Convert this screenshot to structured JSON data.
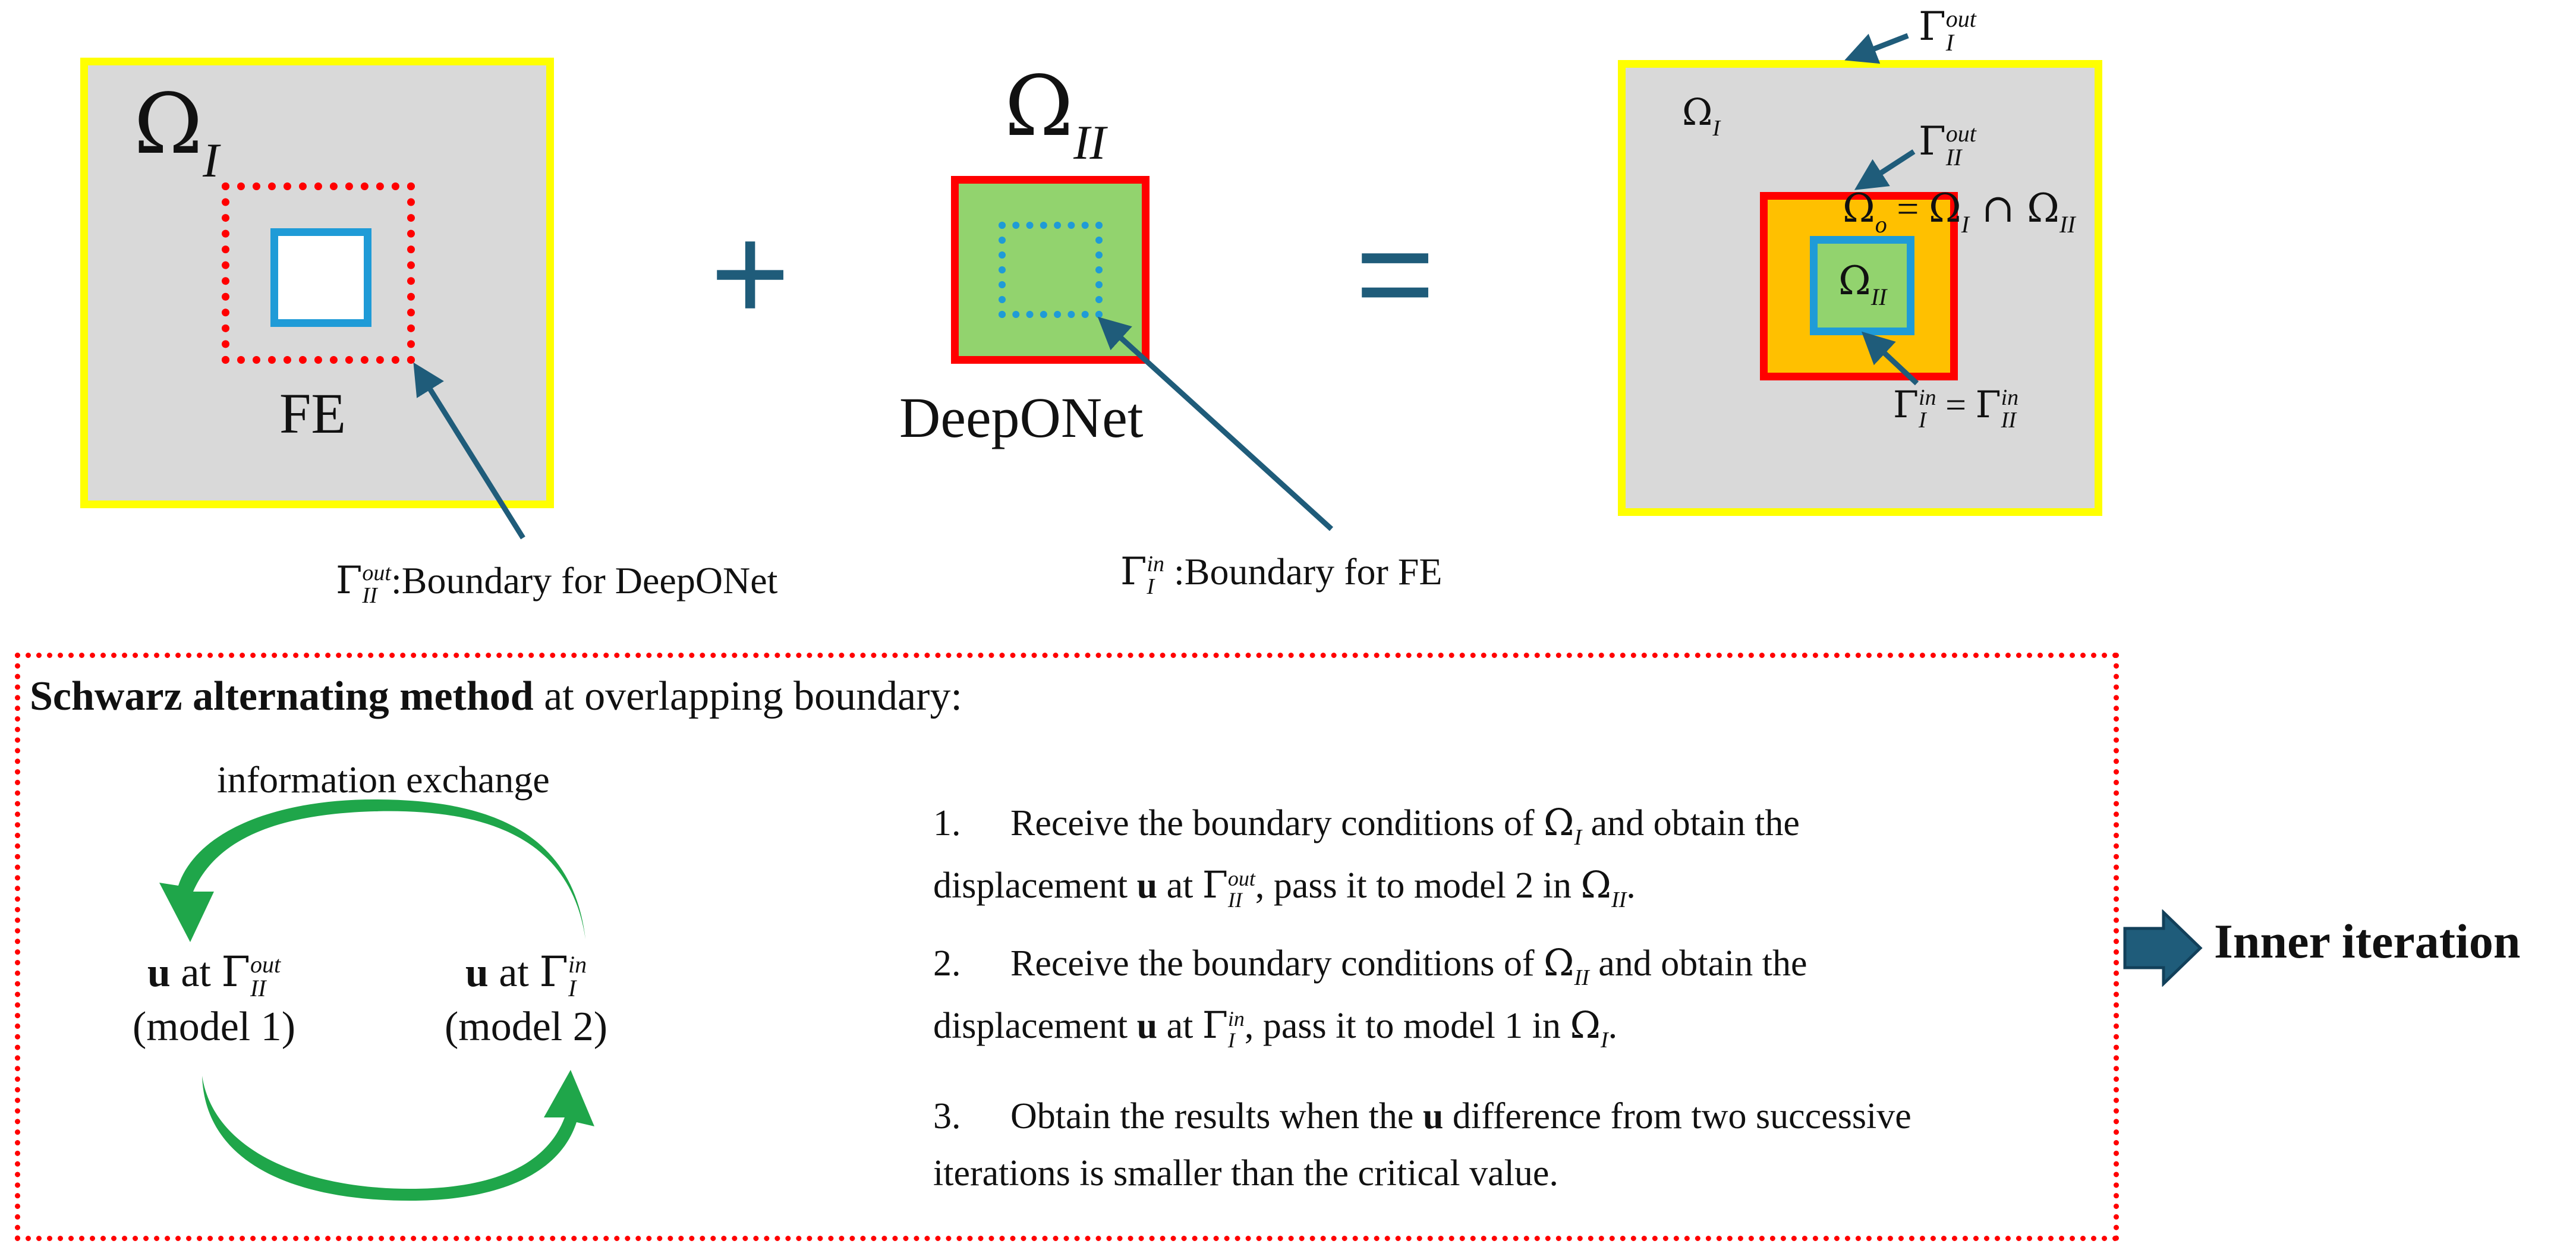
{
  "top": {
    "omega_I_label": {
      "base": "Ω",
      "sub": "I"
    },
    "fe_label": "FE",
    "plus_sign": "+",
    "omega_II_label": {
      "base": "Ω",
      "sub": "II"
    },
    "deeponet_label": "DeepONet",
    "equals_sign": "=",
    "annotation_left": {
      "sym": "Γ",
      "sup": "out",
      "sub": "II",
      "text": ":Boundary for DeepONet"
    },
    "annotation_mid": {
      "sym": "Γ",
      "sup": "in",
      "sub": "I",
      "text": " :Boundary for FE"
    }
  },
  "composite": {
    "gamma_I_out": {
      "sym": "Γ",
      "sup": "out",
      "sub": "I"
    },
    "omega_I": {
      "base": "Ω",
      "sub": "I"
    },
    "gamma_II_out": {
      "sym": "Γ",
      "sup": "out",
      "sub": "II"
    },
    "omega_o_eq": {
      "o_base": "Ω",
      "o_sub": "o",
      "eq": " = ",
      "a_base": "Ω",
      "a_sub": "I",
      "cap": " ∩ ",
      "b_base": "Ω",
      "b_sub": "II"
    },
    "omega_II": {
      "base": "Ω",
      "sub": "II"
    },
    "gamma_in_eq": {
      "a": "Γ",
      "a_sup": "in",
      "a_sub": "I",
      "eq": " = ",
      "b": "Γ",
      "b_sup": "in",
      "b_sub": "II"
    }
  },
  "method": {
    "title_bold": "Schwarz alternating method",
    "title_rest": " at overlapping boundary:",
    "info_exchange": "information exchange",
    "left_node": {
      "u": "u",
      "at": " at ",
      "sym": "Γ",
      "sup": "out",
      "sub": "II",
      "model": "(model 1)"
    },
    "right_node": {
      "u": "u",
      "at": " at ",
      "sym": "Γ",
      "sup": "in",
      "sub": "I",
      "model": "(model 2)"
    },
    "steps": [
      {
        "num": "1.",
        "l1a": "Receive the boundary conditions of ",
        "l1sym": "Ω",
        "l1sub": "I",
        "l1b": " and obtain the",
        "l2a": "displacement ",
        "l2u": "u",
        "l2b": " at ",
        "l2sym": "Γ",
        "l2sup": "out",
        "l2sub": "II",
        "l2c": ", pass it to model 2 in ",
        "l2sym2": "Ω",
        "l2sub2": "II",
        "l2d": "."
      },
      {
        "num": "2.",
        "l1a": "Receive the boundary conditions of ",
        "l1sym": "Ω",
        "l1sub": "II",
        "l1b": " and obtain the",
        "l2a": "displacement ",
        "l2u": "u",
        "l2b": " at ",
        "l2sym": "Γ",
        "l2sup": "in",
        "l2sub": "I",
        "l2c": ", pass it to model 1 in ",
        "l2sym2": "Ω",
        "l2sub2": "I",
        "l2d": "."
      },
      {
        "num": "3.",
        "l1a": "Obtain the results when the ",
        "l1u": "u",
        "l1b": " difference from two successive",
        "l2": "iterations is smaller than the critical value."
      }
    ],
    "inner_iteration": "Inner iteration"
  },
  "colors": {
    "gray_domain": "#d9d9d9",
    "yellow_border": "#ffff00",
    "red_border": "#ff0000",
    "blue_border": "#1f9bd7",
    "green_fill": "#92d36e",
    "orange_fill": "#ffc000",
    "arrow_blue": "#1f5c7a",
    "cycle_green": "#1fa64a"
  }
}
